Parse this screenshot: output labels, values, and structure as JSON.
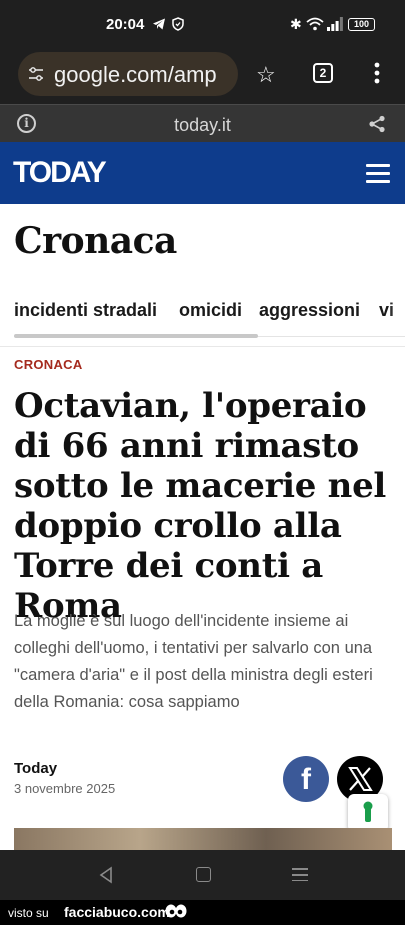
{
  "status_bar": {
    "time": "20:04",
    "battery": "100"
  },
  "browser": {
    "url": "google.com/amp",
    "tab_count": "2",
    "site_domain": "today.it"
  },
  "site": {
    "logo": "TODAY"
  },
  "section": {
    "title": "Cronaca",
    "topics": [
      "incidenti stradali",
      "omicidi",
      "aggressioni",
      "vi"
    ]
  },
  "article": {
    "kicker": "CRONACA",
    "headline": "Octavian, l'operaio di 66 anni rimasto sotto le macerie nel doppio crollo alla Torre dei conti a Roma",
    "summary": "La moglie è sul luogo dell'incidente insieme ai colleghi dell'uomo, i tentativi per salvarlo con una \"camera d'aria\" e il post della ministra degli esteri della Romania: cosa sappiamo",
    "author": "Today",
    "date": "3 novembre 2025"
  },
  "share": {
    "facebook_glyph": "f"
  },
  "watermark": {
    "prefix": "visto su",
    "site": "facciabuco.com"
  },
  "colors": {
    "header_blue": "#0e3c8c",
    "kicker_red": "#a52a1e",
    "facebook_blue": "#3b5998"
  }
}
